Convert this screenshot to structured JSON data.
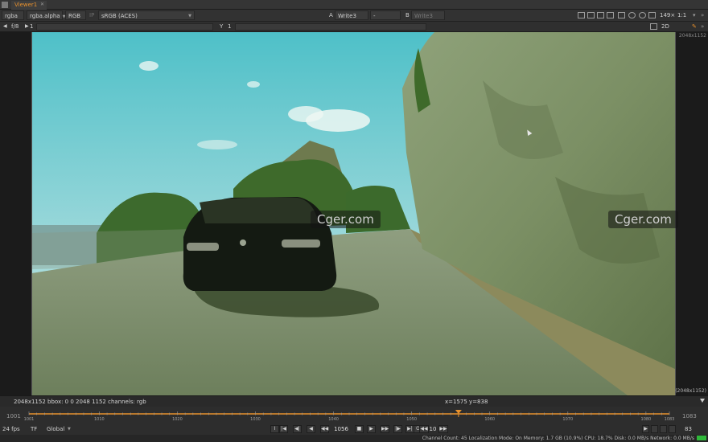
{
  "window": {
    "tab_label": "Viewer1"
  },
  "toolbar": {
    "channels": "rgba",
    "channel_alpha": "rgba.alpha",
    "display_mode": "RGB",
    "ip_label": "IP",
    "colorspace": "sRGB (ACES)",
    "input_a_letter": "A",
    "input_a": "Write3",
    "compare_mode": "-",
    "input_b_letter": "B",
    "input_b": "Write3",
    "zoom": "149×",
    "proxy_ratio": "1:1"
  },
  "toolbar2": {
    "fstop": "f/8",
    "gain_value": "1",
    "y_label": "Y",
    "gamma_value": "1",
    "view_mode": "2D"
  },
  "viewer": {
    "resolution_top": "2048x1152",
    "resolution_bottom": "(2048x1152)",
    "watermarks": [
      "Cger.com",
      "Cger.com"
    ]
  },
  "infobar": {
    "format_info": "2048x1152  bbox: 0 0 2048 1152 channels: rgb",
    "cursor_pos": "x=1575 y=838"
  },
  "timeline": {
    "start_outer": "1001",
    "end_outer": "1083",
    "range_start": 1001,
    "range_end": 1083,
    "current_frame": 1056,
    "tick_labels": [
      "1001",
      "1010",
      "1020",
      "1030",
      "1040",
      "1050",
      "1060",
      "1070",
      "1080",
      "1083"
    ]
  },
  "transport": {
    "fps": "24 fps",
    "timecode_mode": "TF",
    "range_mode": "Global",
    "current_frame_display": "1056",
    "increment": "10",
    "out_frame": "83",
    "buttons": [
      "I",
      "|◀",
      "◀|",
      "◀",
      "◀◀",
      "■",
      "▶",
      "▶▶",
      "|▶",
      "▶|",
      "O"
    ]
  },
  "status": {
    "text": "Channel Count: 45  Localization Mode: On  Memory: 1.7 GB (10.9%)  CPU: 18.7%  Disk: 0.0 MB/s  Network: 0.0 MB/s"
  },
  "colors": {
    "accent_orange": "#e8912d",
    "status_green": "#2fb83a"
  }
}
